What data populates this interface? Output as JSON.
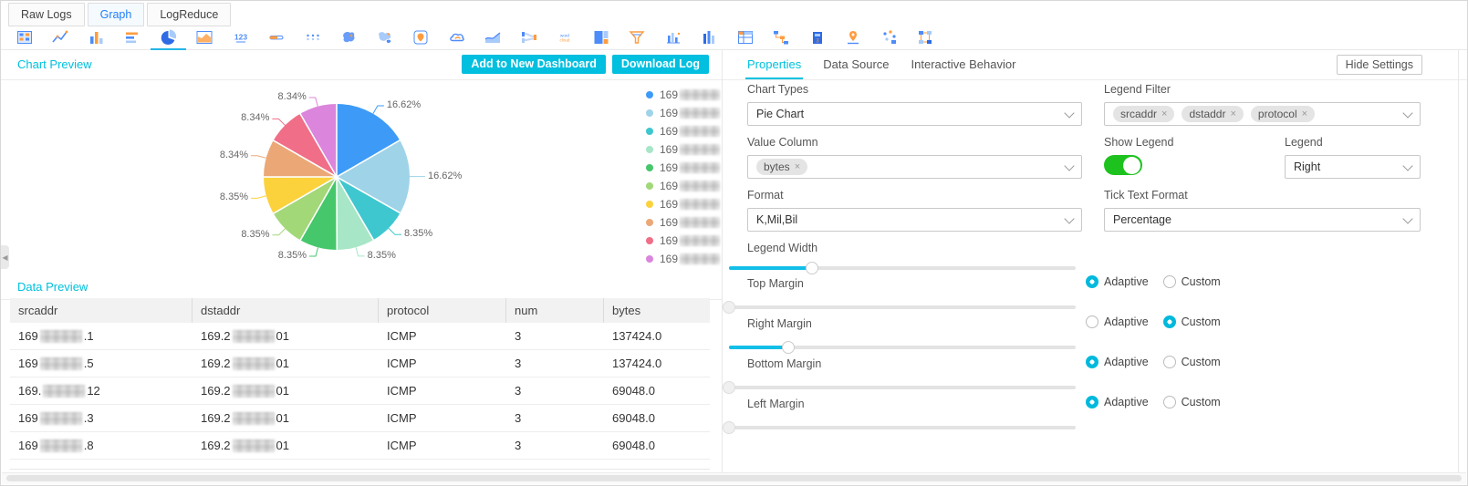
{
  "top_tabs": [
    {
      "label": "Raw Logs",
      "active": false
    },
    {
      "label": "Graph",
      "active": true
    },
    {
      "label": "LogReduce",
      "active": false
    }
  ],
  "toolbar": {
    "selected_index": 4,
    "icons": [
      {
        "name": "table-chart"
      },
      {
        "name": "line-chart"
      },
      {
        "name": "column-chart"
      },
      {
        "name": "bar-chart"
      },
      {
        "name": "pie-chart"
      },
      {
        "name": "area-chart"
      },
      {
        "name": "single-value"
      },
      {
        "name": "progress-bar"
      },
      {
        "name": "dot-matrix"
      },
      {
        "name": "china-map"
      },
      {
        "name": "world-map"
      },
      {
        "name": "pin-map"
      },
      {
        "name": "amap"
      },
      {
        "name": "flow-chart"
      },
      {
        "name": "sankey"
      },
      {
        "name": "word-cloud"
      },
      {
        "name": "treemap"
      },
      {
        "name": "funnel"
      },
      {
        "name": "histogram"
      },
      {
        "name": "column-3d"
      },
      {
        "name": "cross-table"
      },
      {
        "name": "tree-diagram"
      },
      {
        "name": "map-3d"
      },
      {
        "name": "track-map"
      },
      {
        "name": "scatter"
      },
      {
        "name": "topology"
      }
    ]
  },
  "chart_preview": {
    "title": "Chart Preview",
    "add_to_dashboard_label": "Add to New Dashboard",
    "download_log_label": "Download Log"
  },
  "chart_data": {
    "type": "pie",
    "value_column": "bytes",
    "tick_text_format": "Percentage",
    "legend_position": "right",
    "slices": [
      {
        "label_prefix": "169",
        "label_masked": true,
        "value_percent": 16.62,
        "color": "#3d9bf7"
      },
      {
        "label_prefix": "169",
        "label_masked": true,
        "value_percent": 16.62,
        "color": "#9fd3e8"
      },
      {
        "label_prefix": "169",
        "label_masked": true,
        "value_percent": 8.35,
        "color": "#3ec7ce"
      },
      {
        "label_prefix": "169",
        "label_masked": true,
        "value_percent": 8.35,
        "color": "#a7e6c6"
      },
      {
        "label_prefix": "169",
        "label_masked": true,
        "value_percent": 8.35,
        "color": "#46c76b"
      },
      {
        "label_prefix": "169",
        "label_masked": true,
        "value_percent": 8.35,
        "color": "#a2d878"
      },
      {
        "label_prefix": "169",
        "label_masked": true,
        "value_percent": 8.35,
        "color": "#fbd23c"
      },
      {
        "label_prefix": "169",
        "label_masked": true,
        "value_percent": 8.34,
        "color": "#eba876"
      },
      {
        "label_prefix": "169",
        "label_masked": true,
        "value_percent": 8.34,
        "color": "#f06e87"
      },
      {
        "label_prefix": "169",
        "label_masked": true,
        "value_percent": 8.34,
        "color": "#db85dc"
      }
    ]
  },
  "data_preview": {
    "title": "Data Preview",
    "columns": [
      "srcaddr",
      "dstaddr",
      "protocol",
      "num",
      "bytes"
    ],
    "rows": [
      {
        "srcaddr": {
          "prefix": "169",
          "masked": true,
          "suffix": ".1"
        },
        "dstaddr": {
          "prefix": "169.2",
          "masked": true,
          "suffix": "01"
        },
        "protocol": "ICMP",
        "num": "3",
        "bytes": "137424.0"
      },
      {
        "srcaddr": {
          "prefix": "169",
          "masked": true,
          "suffix": ".5"
        },
        "dstaddr": {
          "prefix": "169.2",
          "masked": true,
          "suffix": "01"
        },
        "protocol": "ICMP",
        "num": "3",
        "bytes": "137424.0"
      },
      {
        "srcaddr": {
          "prefix": "169.",
          "masked": true,
          "suffix": " 12"
        },
        "dstaddr": {
          "prefix": "169.2",
          "masked": true,
          "suffix": "01"
        },
        "protocol": "ICMP",
        "num": "3",
        "bytes": "69048.0"
      },
      {
        "srcaddr": {
          "prefix": "169",
          "masked": true,
          "suffix": ".3"
        },
        "dstaddr": {
          "prefix": "169.2",
          "masked": true,
          "suffix": "01"
        },
        "protocol": "ICMP",
        "num": "3",
        "bytes": "69048.0"
      },
      {
        "srcaddr": {
          "prefix": "169",
          "masked": true,
          "suffix": ".8"
        },
        "dstaddr": {
          "prefix": "169.2",
          "masked": true,
          "suffix": "01"
        },
        "protocol": "ICMP",
        "num": "3",
        "bytes": "69048.0"
      }
    ]
  },
  "settings": {
    "tabs": [
      {
        "label": "Properties",
        "active": true
      },
      {
        "label": "Data Source",
        "active": false
      },
      {
        "label": "Interactive Behavior",
        "active": false
      }
    ],
    "hide_settings_label": "Hide Settings",
    "fields": {
      "chart_types": {
        "label": "Chart Types",
        "value": "Pie Chart"
      },
      "legend_filter": {
        "label": "Legend Filter",
        "tags": [
          "srcaddr",
          "dstaddr",
          "protocol"
        ]
      },
      "value_column": {
        "label": "Value Column",
        "tags": [
          "bytes"
        ]
      },
      "show_legend": {
        "label": "Show Legend",
        "on": true
      },
      "legend_position": {
        "label": "Legend",
        "value": "Right"
      },
      "format": {
        "label": "Format",
        "value": "K,Mil,Bil"
      },
      "tick_text_format": {
        "label": "Tick Text Format",
        "value": "Percentage"
      },
      "legend_width": {
        "label": "Legend Width",
        "percent": 24
      },
      "margin_options": [
        "Adaptive",
        "Custom"
      ],
      "margins": [
        {
          "label": "Top Margin",
          "percent": 0,
          "mode": "Adaptive"
        },
        {
          "label": "Right Margin",
          "percent": 17,
          "mode": "Custom"
        },
        {
          "label": "Bottom Margin",
          "percent": 0,
          "mode": "Adaptive"
        },
        {
          "label": "Left Margin",
          "percent": 0,
          "mode": "Adaptive"
        }
      ]
    }
  },
  "colors": {
    "accent_cyan": "#00c1de",
    "button_cyan": "#00bfdf",
    "active_tab_blue": "#2080f7",
    "toggle_green": "#1ec21e"
  }
}
